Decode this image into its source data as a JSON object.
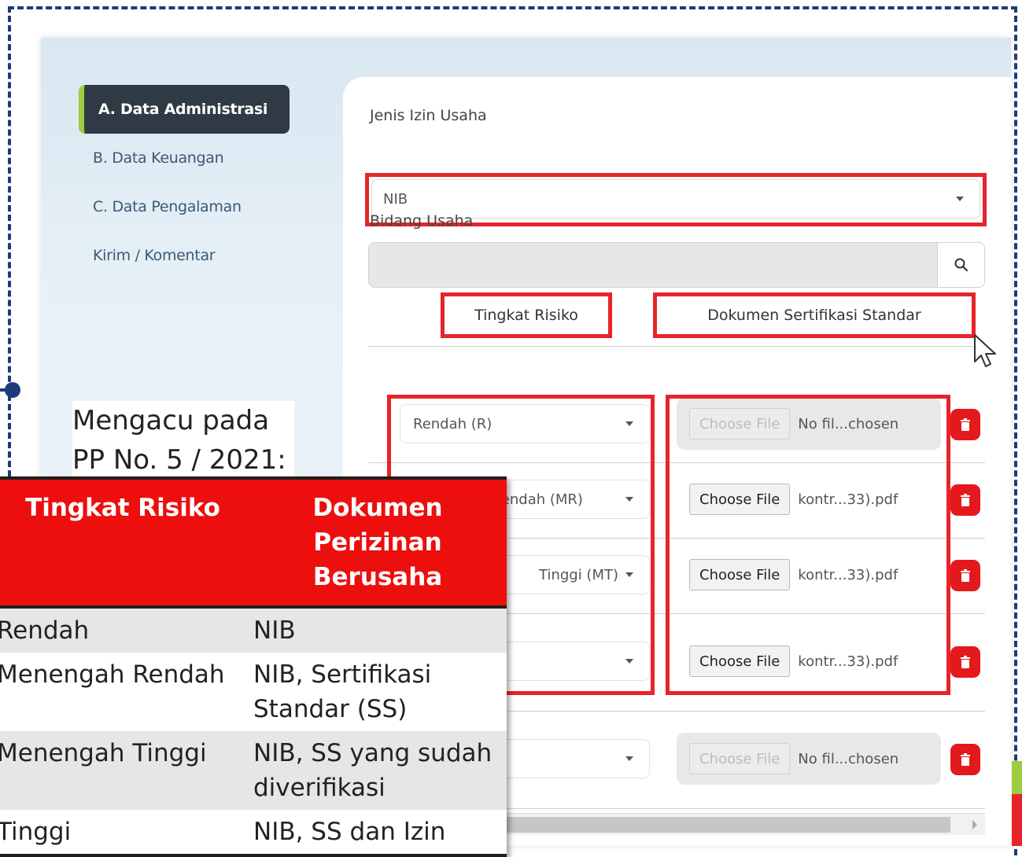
{
  "sidebar": {
    "items": [
      {
        "label": "A. Data Administrasi",
        "active": true
      },
      {
        "label": "B. Data Keuangan",
        "active": false
      },
      {
        "label": "C. Data Pengalaman",
        "active": false
      },
      {
        "label": "Kirim / Komentar",
        "active": false
      }
    ]
  },
  "form": {
    "jenis_label": "Jenis Izin Usaha",
    "jenis_value": "NIB",
    "bidang_label": "Bidang Usaha",
    "bidang_value": "",
    "col_risk": "Tingkat Risiko",
    "col_doc": "Dokumen Sertifikasi Standar",
    "rows": [
      {
        "risk": "Rendah (R)",
        "file_button": "Choose File",
        "file_name": "No fil...chosen",
        "disabled": true
      },
      {
        "risk": "Menengah Rendah (MR)",
        "file_button": "Choose File",
        "file_name": "kontr...33).pdf",
        "disabled": false
      },
      {
        "risk": "Tinggi (MT)",
        "file_button": "Choose File",
        "file_name": "kontr...33).pdf",
        "disabled": false
      },
      {
        "risk": "",
        "file_button": "Choose File",
        "file_name": "kontr...33).pdf",
        "disabled": false
      },
      {
        "risk": "",
        "file_button": "Choose File",
        "file_name": "No fil...chosen",
        "disabled": true
      }
    ]
  },
  "callout": {
    "line1": "Mengacu pada",
    "line2": "PP No. 5 / 2021:"
  },
  "ref_table": {
    "headers": [
      "Tingkat Risiko",
      "Dokumen Perizinan Berusaha"
    ],
    "rows": [
      [
        "Rendah",
        "NIB"
      ],
      [
        "Menengah Rendah",
        "NIB, Sertifikasi Standar (SS)"
      ],
      [
        "Menengah Tinggi",
        "NIB, SS yang  sudah diverifikasi"
      ],
      [
        "Tinggi",
        "NIB, SS dan Izin"
      ]
    ]
  },
  "icons": {
    "search": "search-icon",
    "trash": "trash-icon",
    "caret": "chevron-down-icon",
    "cursor": "mouse-cursor-icon"
  },
  "colors": {
    "highlight": "#e8232a",
    "header_red": "#ed0e0e",
    "active_accent": "#9ccc3f",
    "frame": "#1f3a78",
    "trash": "#e3191d"
  }
}
